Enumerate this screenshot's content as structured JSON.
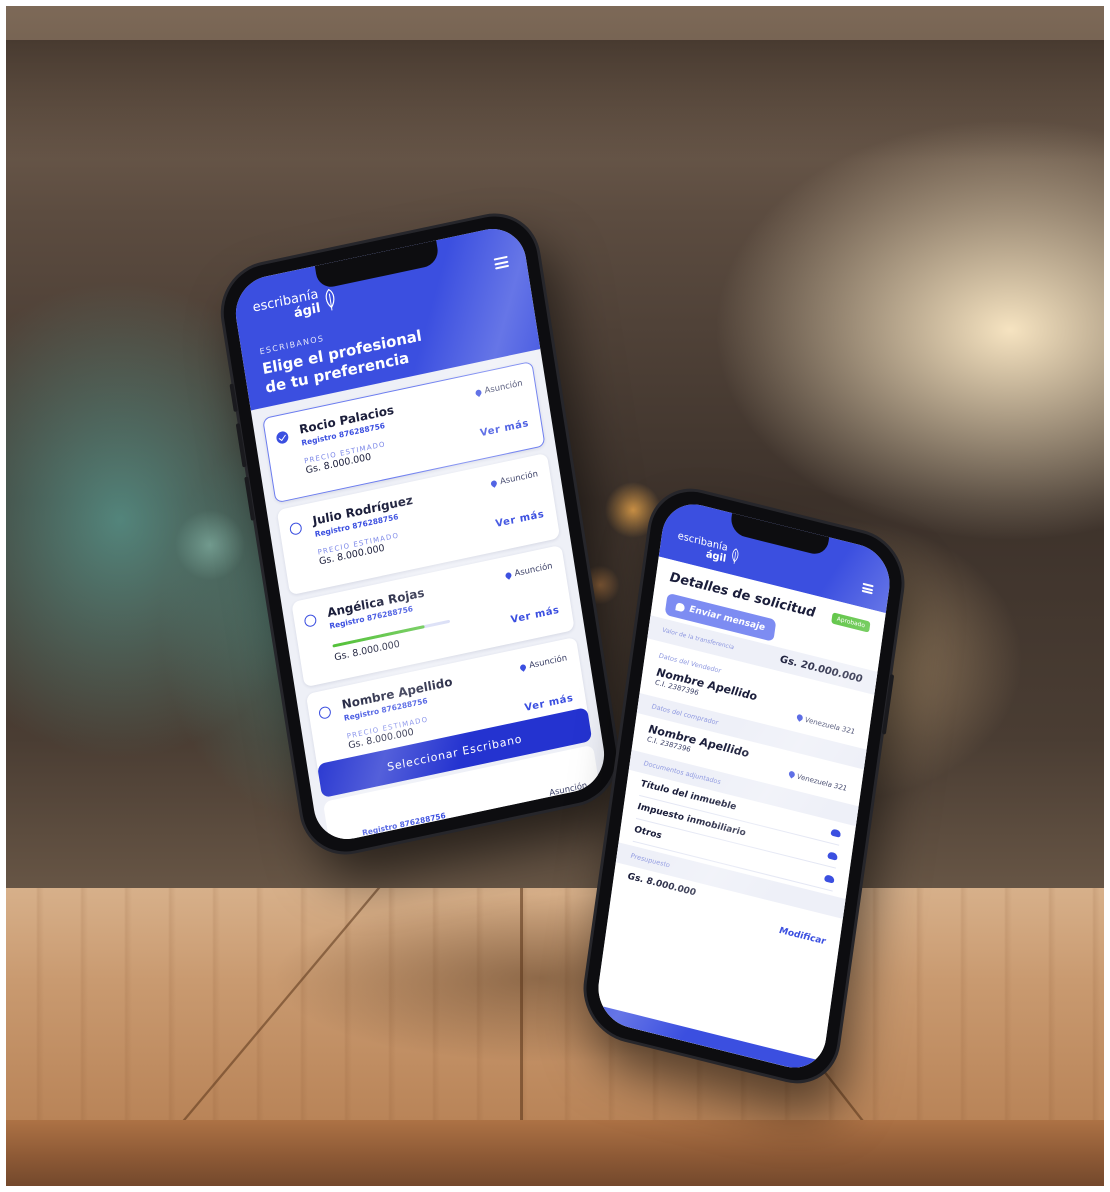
{
  "brand": {
    "line1": "escribanía",
    "line2": "ágil"
  },
  "list_screen": {
    "kicker": "ESCRIBANOS",
    "title_line1": "Elige el profesional",
    "title_line2": "de tu preferencia",
    "price_label": "PRECIO ESTIMADO",
    "more_label": "Ver más",
    "cta_label": "Seleccionar Escribano",
    "cards": [
      {
        "name": "Rocio Palacios",
        "registry": "Registro 876288756",
        "city": "Asunción",
        "price": "Gs. 8.000.000",
        "selected": true
      },
      {
        "name": "Julio Rodríguez",
        "registry": "Registro 876288756",
        "city": "Asunción",
        "price": "Gs. 8.000.000",
        "selected": false
      },
      {
        "name": "Angélica Rojas",
        "registry": "Registro 876288756",
        "city": "Asunción",
        "price": "Gs. 8.000.000",
        "selected": false,
        "progress": 0.78
      },
      {
        "name": "Nombre Apellido",
        "registry": "Registro 876288756",
        "city": "Asunción",
        "price": "Gs. 8.000.000",
        "selected": false
      }
    ],
    "peek": {
      "registry": "Registro 876288756",
      "city": "Asunción"
    }
  },
  "detail_screen": {
    "title": "Detalles de solicitud",
    "badge": "Aprobado",
    "message_button": "Enviar mensaje",
    "transfer_label": "Valor de la transferencia",
    "transfer_value": "Gs. 20.000.000",
    "seller_label": "Datos del Vendedor",
    "seller_name": "Nombre Apellido",
    "seller_id": "C.I. 2387396",
    "seller_address": "Venezuela 321",
    "buyer_label": "Datos del comprador",
    "buyer_name": "Nombre Apellido",
    "buyer_id": "C.I. 2387396",
    "buyer_address": "Venezuela 321",
    "docs_label": "Documentos adjuntados",
    "documents": [
      "Título del inmueble",
      "Impuesto inmobiliario",
      "Otros"
    ],
    "budget_label": "Presupuesto",
    "budget_value": "Gs. 8.000.000",
    "modify_label": "Modificar"
  },
  "colors": {
    "brand_blue": "#3b4fe0",
    "cta_blue": "#2433d0",
    "approved_green": "#57c23d"
  }
}
